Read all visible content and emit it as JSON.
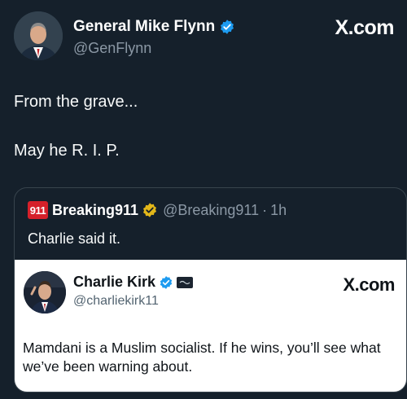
{
  "post": {
    "author_name": "General Mike Flynn",
    "author_handle": "@GenFlynn",
    "brand": "X.com",
    "text_line1": "From the grave...",
    "text_line2": "May he R. I. P.",
    "verified_icon": "blue-verified-icon"
  },
  "quote": {
    "logo_text": "911",
    "account_name": "Breaking911",
    "handle": "@Breaking911",
    "separator": "·",
    "time": "1h",
    "text": "Charlie said it.",
    "verified_icon": "gold-verified-icon"
  },
  "embedded_card": {
    "author_name": "Charlie Kirk",
    "author_handle": "@charliekirk11",
    "brand": "X.com",
    "text": "Mamdani is a Muslim socialist. If he wins, you’ll see what we’ve been warning about.",
    "badge_icon": "affiliate-badge-icon"
  },
  "colors": {
    "background": "#15202b",
    "verified_blue": "#1d9bf0",
    "gold": "#e2b719",
    "breaking_red": "#d6202a"
  }
}
